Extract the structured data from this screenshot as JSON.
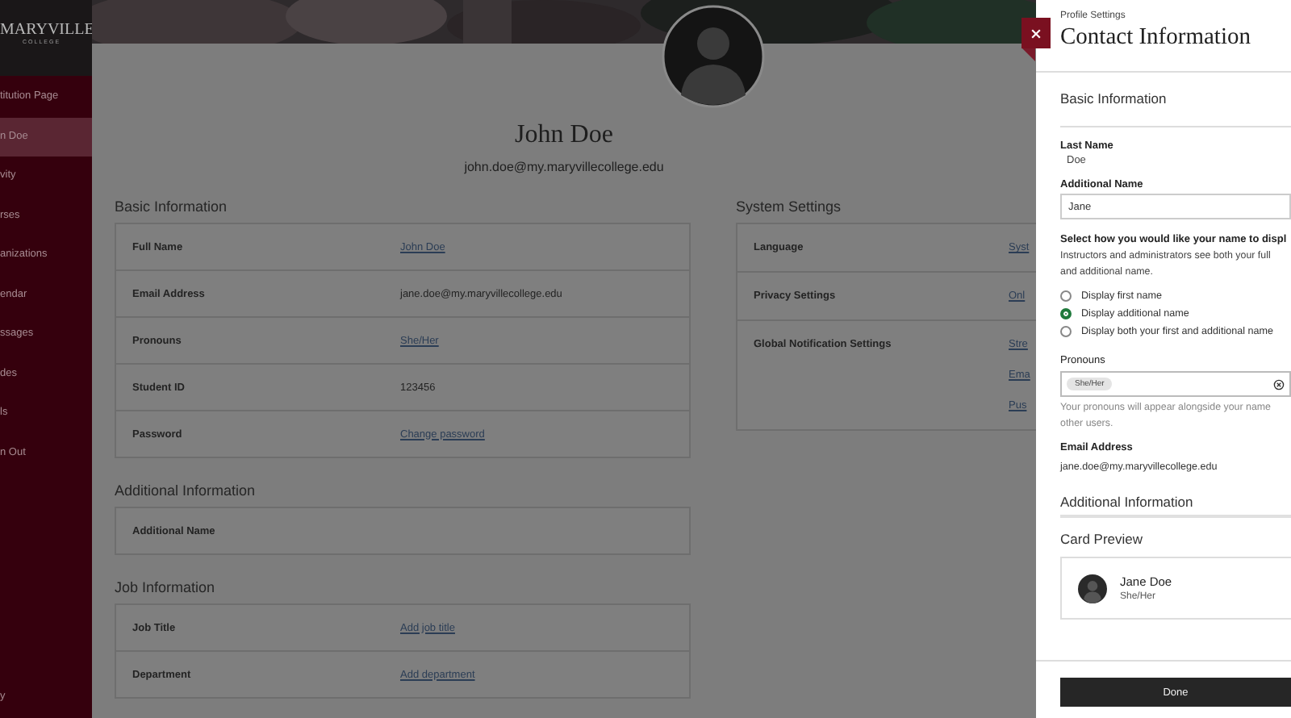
{
  "sidebar": {
    "logo": {
      "name": "MARYVILLE",
      "subtitle": "COLLEGE"
    },
    "items": [
      {
        "label": "titution Page",
        "selected": false
      },
      {
        "label": "n Doe",
        "selected": true
      },
      {
        "label": "vity",
        "selected": false
      },
      {
        "label": "rses",
        "selected": false
      },
      {
        "label": "anizations",
        "selected": false
      },
      {
        "label": "endar",
        "selected": false
      },
      {
        "label": "ssages",
        "selected": false
      },
      {
        "label": "des",
        "selected": false
      },
      {
        "label": "ls",
        "selected": false
      },
      {
        "label": "n Out",
        "selected": false
      }
    ],
    "footer": "y"
  },
  "profile": {
    "name": "John Doe",
    "email": "john.doe@my.maryvillecollege.edu",
    "sections": [
      {
        "title": "Basic Information",
        "rows": [
          {
            "label": "Full Name",
            "kind": "link",
            "value": "John Doe"
          },
          {
            "label": "Email Address",
            "kind": "text",
            "value": "jane.doe@my.maryvillecollege.edu"
          },
          {
            "label": "Pronouns",
            "kind": "link",
            "value": "She/Her"
          },
          {
            "label": "Student ID",
            "kind": "text",
            "value": "123456"
          },
          {
            "label": "Password",
            "kind": "link",
            "value": "Change password"
          }
        ]
      },
      {
        "title": "Additional Information",
        "rows": [
          {
            "label": "Additional Name"
          }
        ]
      },
      {
        "title": "Job Information",
        "rows": [
          {
            "label": "Job Title",
            "kind": "link",
            "value": "Add job title"
          },
          {
            "label": "Department",
            "kind": "link",
            "value": "Add department"
          }
        ]
      }
    ],
    "system_settings": {
      "title": "System Settings",
      "rows": [
        {
          "label": "Language",
          "values": [
            "Syst"
          ]
        },
        {
          "label": "Privacy Settings",
          "values": [
            "Onl"
          ]
        },
        {
          "label": "Global Notification Settings",
          "values": [
            "Stre",
            "Ema",
            "Pus"
          ]
        }
      ]
    }
  },
  "panel": {
    "breadcrumb": "Profile Settings",
    "title": "Contact Information",
    "section_title": "Basic Information",
    "last_name": {
      "label": "Last Name",
      "value": "Doe"
    },
    "additional_name": {
      "label": "Additional Name",
      "value": "Jane"
    },
    "display_prompt": "Select how you would like your name to displ",
    "display_help": [
      "Instructors and administrators see both your full",
      "and additional name."
    ],
    "options": [
      {
        "label": "Display first name",
        "selected": false
      },
      {
        "label": "Display additional name",
        "selected": true
      },
      {
        "label": "Display both your first and additional name",
        "selected": false
      }
    ],
    "pronouns": {
      "label": "Pronouns",
      "tags": [
        "She/Her"
      ]
    },
    "pronouns_help": [
      "Your pronouns will appear alongside your name",
      "other users."
    ],
    "email": {
      "label": "Email Address",
      "value": "jane.doe@my.maryvillecollege.edu"
    },
    "additional_heading": "Additional Information",
    "card_preview": {
      "title": "Card Preview",
      "name": "Jane Doe",
      "pronouns": "She/Her"
    },
    "done": "Done"
  }
}
